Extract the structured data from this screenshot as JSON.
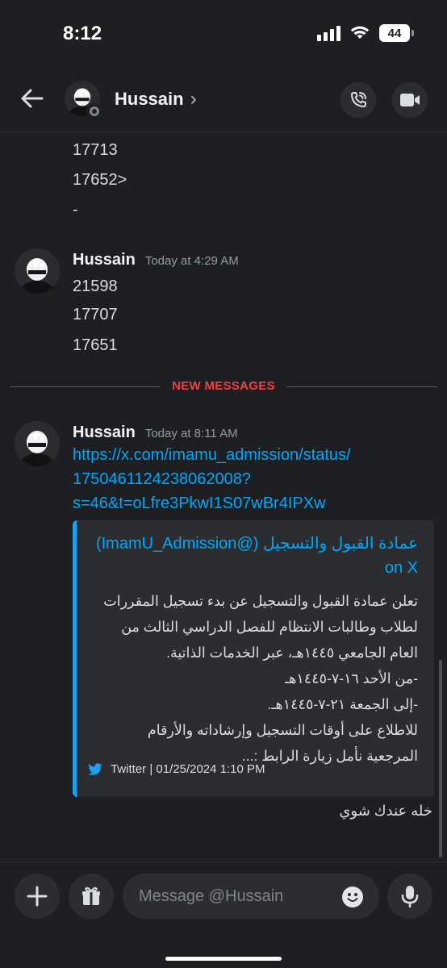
{
  "status_bar": {
    "time": "8:12",
    "battery": "44"
  },
  "header": {
    "username": "Hussain",
    "chevron": "›"
  },
  "colors": {
    "background": "#1e1f22",
    "link": "#00a8fc",
    "new_messages": "#f23f43",
    "twitter": "#1da1f2"
  },
  "icons": [
    "back-arrow-icon",
    "phone-icon",
    "video-icon",
    "plus-icon",
    "gift-icon",
    "emoji-icon",
    "microphone-icon",
    "twitter-bird-icon"
  ],
  "messages": {
    "continued_lines": [
      "17713",
      "17652>",
      "-"
    ],
    "group1": {
      "author": "Hussain",
      "time": "Today at 4:29 AM",
      "lines": [
        "21598",
        "17707",
        "17651"
      ]
    },
    "divider": "NEW MESSAGES",
    "group2": {
      "author": "Hussain",
      "time": "Today at 8:11 AM",
      "link_lines": [
        "https://x.com/imamu_admission/status/",
        "1750461124238062008?",
        "s=46&t=oLfre3PkwI1S07wBr4IPXw"
      ],
      "embed": {
        "title": "عمادة القبول والتسجيل (@ImamU_Admission) on X",
        "description": [
          "تعلن عمادة القبول والتسجيل عن بدء تسجيل المقررات",
          "لطلاب وطالبات الانتظام للفصل الدراسي الثالث من",
          "العام الجامعي ١٤٤٥هـ، عبر الخدمات الذاتية.",
          "-من الأحد ١٦-٧-١٤٤٥هـ",
          "-إلى الجمعة ٢١-٧-١٤٤٥هـ.",
          "للاطلاع على أوقات التسجيل وإرشاداته والأرقام",
          "المرجعية نأمل زيارة الرابط :..."
        ],
        "footer": "Twitter | 01/25/2024 1:10 PM"
      },
      "reply": "خله عندك شوي"
    }
  },
  "composer": {
    "placeholder": "Message @Hussain"
  }
}
